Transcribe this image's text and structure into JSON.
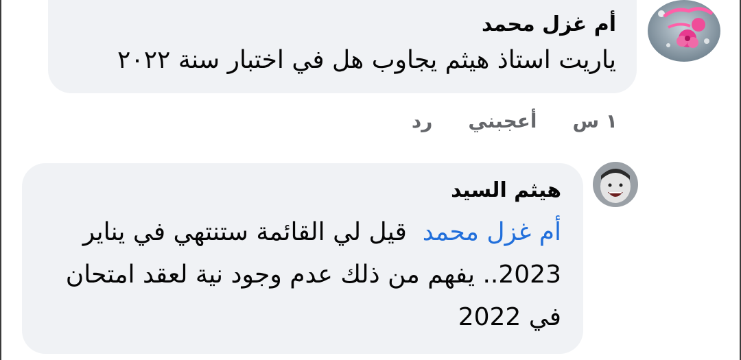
{
  "comment1": {
    "avatar_icon": "profile-picture-pink-flowers",
    "author": "أم غزل محمد",
    "text": "ياريت استاذ هيثم يجاوب هل في اختبار سنة ٢٠٢٢",
    "actions": {
      "time": "١ س",
      "like": "أعجبني",
      "reply": "رد"
    }
  },
  "comment2": {
    "avatar_icon": "profile-picture-laughing-child",
    "author": "هيثم السيد",
    "mention": "أم غزل محمد",
    "text": "قيل لي  القائمة ستنتهي في يناير 2023..  يفهم من ذلك عدم وجود نية لعقد امتحان في 2022"
  },
  "colors": {
    "bubble": "#f0f2f5",
    "mention": "#216fdb",
    "meta": "#65676b"
  }
}
